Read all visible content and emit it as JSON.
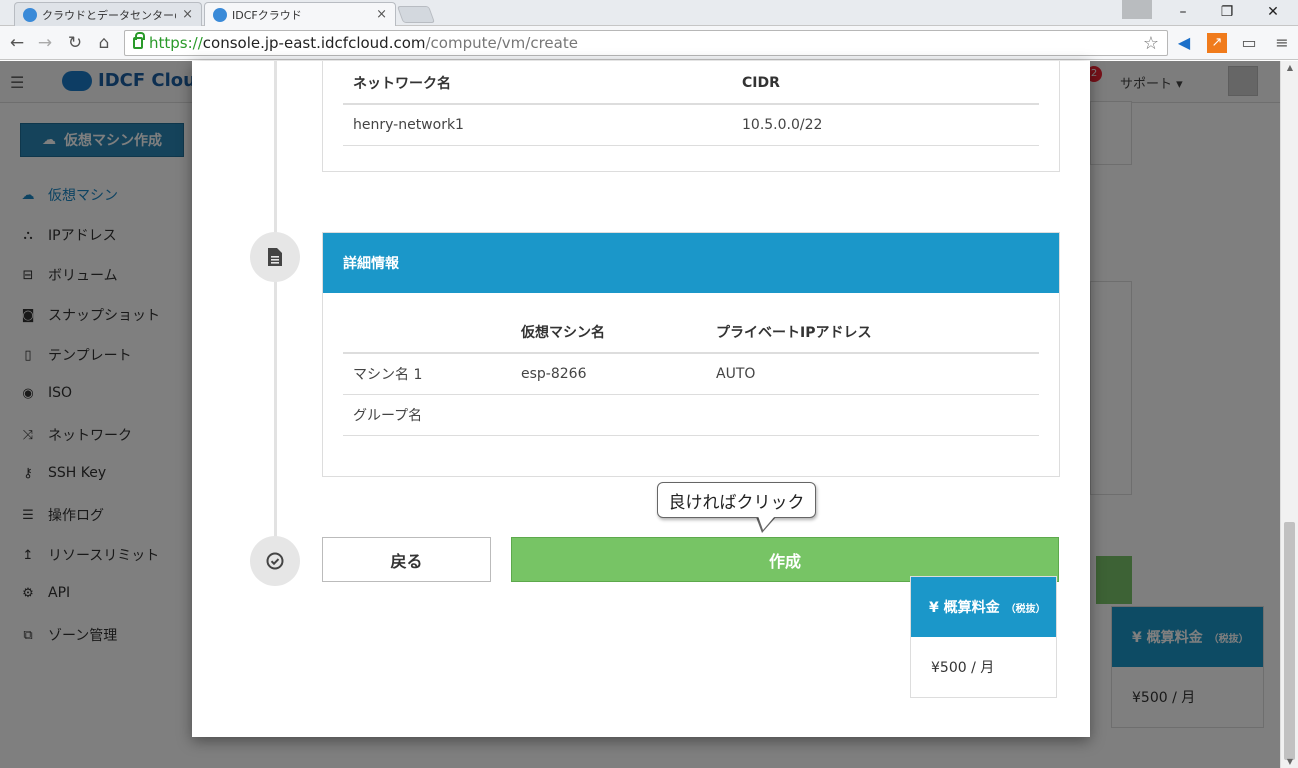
{
  "browser": {
    "tabs": [
      {
        "title": "クラウドとデータセンターのIDCフ"
      },
      {
        "title": "IDCFクラウド"
      }
    ],
    "url": {
      "scheme": "https://",
      "host": "console.jp-east.idcfcloud.com",
      "path": "/compute/vm/create"
    }
  },
  "app": {
    "logo_text": "IDCF Cloud",
    "support_label": "サポート",
    "notification_count": "2",
    "create_vm_button": "仮想マシン作成",
    "sidebar": [
      {
        "label": "仮想マシン",
        "icon": "cloud-icon"
      },
      {
        "label": "IPアドレス",
        "icon": "sitemap-icon"
      },
      {
        "label": "ボリューム",
        "icon": "disk-icon"
      },
      {
        "label": "スナップショット",
        "icon": "camera-icon"
      },
      {
        "label": "テンプレート",
        "icon": "file-icon"
      },
      {
        "label": "ISO",
        "icon": "disc-icon"
      },
      {
        "label": "ネットワーク",
        "icon": "shuffle-icon"
      },
      {
        "label": "SSH Key",
        "icon": "key-icon"
      },
      {
        "label": "操作ログ",
        "icon": "log-icon"
      },
      {
        "label": "リソースリミット",
        "icon": "limit-icon"
      },
      {
        "label": "API",
        "icon": "gears-icon"
      },
      {
        "label": "ゾーン管理",
        "icon": "zone-icon"
      }
    ],
    "bg_price": {
      "title": "¥ 概算料金",
      "tax_note": "（税抜）",
      "value": "¥500 / 月"
    }
  },
  "modal": {
    "network_table": {
      "headers": [
        "ネットワーク名",
        "CIDR"
      ],
      "rows": [
        [
          "henry-network1",
          "10.5.0.0/22"
        ]
      ]
    },
    "details": {
      "title": "詳細情報",
      "headers": [
        "",
        "仮想マシン名",
        "プライベートIPアドレス"
      ],
      "rows": [
        [
          "マシン名 1",
          "esp-8266",
          "AUTO"
        ],
        [
          "グループ名",
          "",
          ""
        ]
      ]
    },
    "back_button": "戻る",
    "create_button": "作成",
    "price": {
      "title": "¥ 概算料金",
      "tax_note": "（税抜）",
      "value": "¥500 / 月"
    },
    "callout": "良ければクリック"
  }
}
